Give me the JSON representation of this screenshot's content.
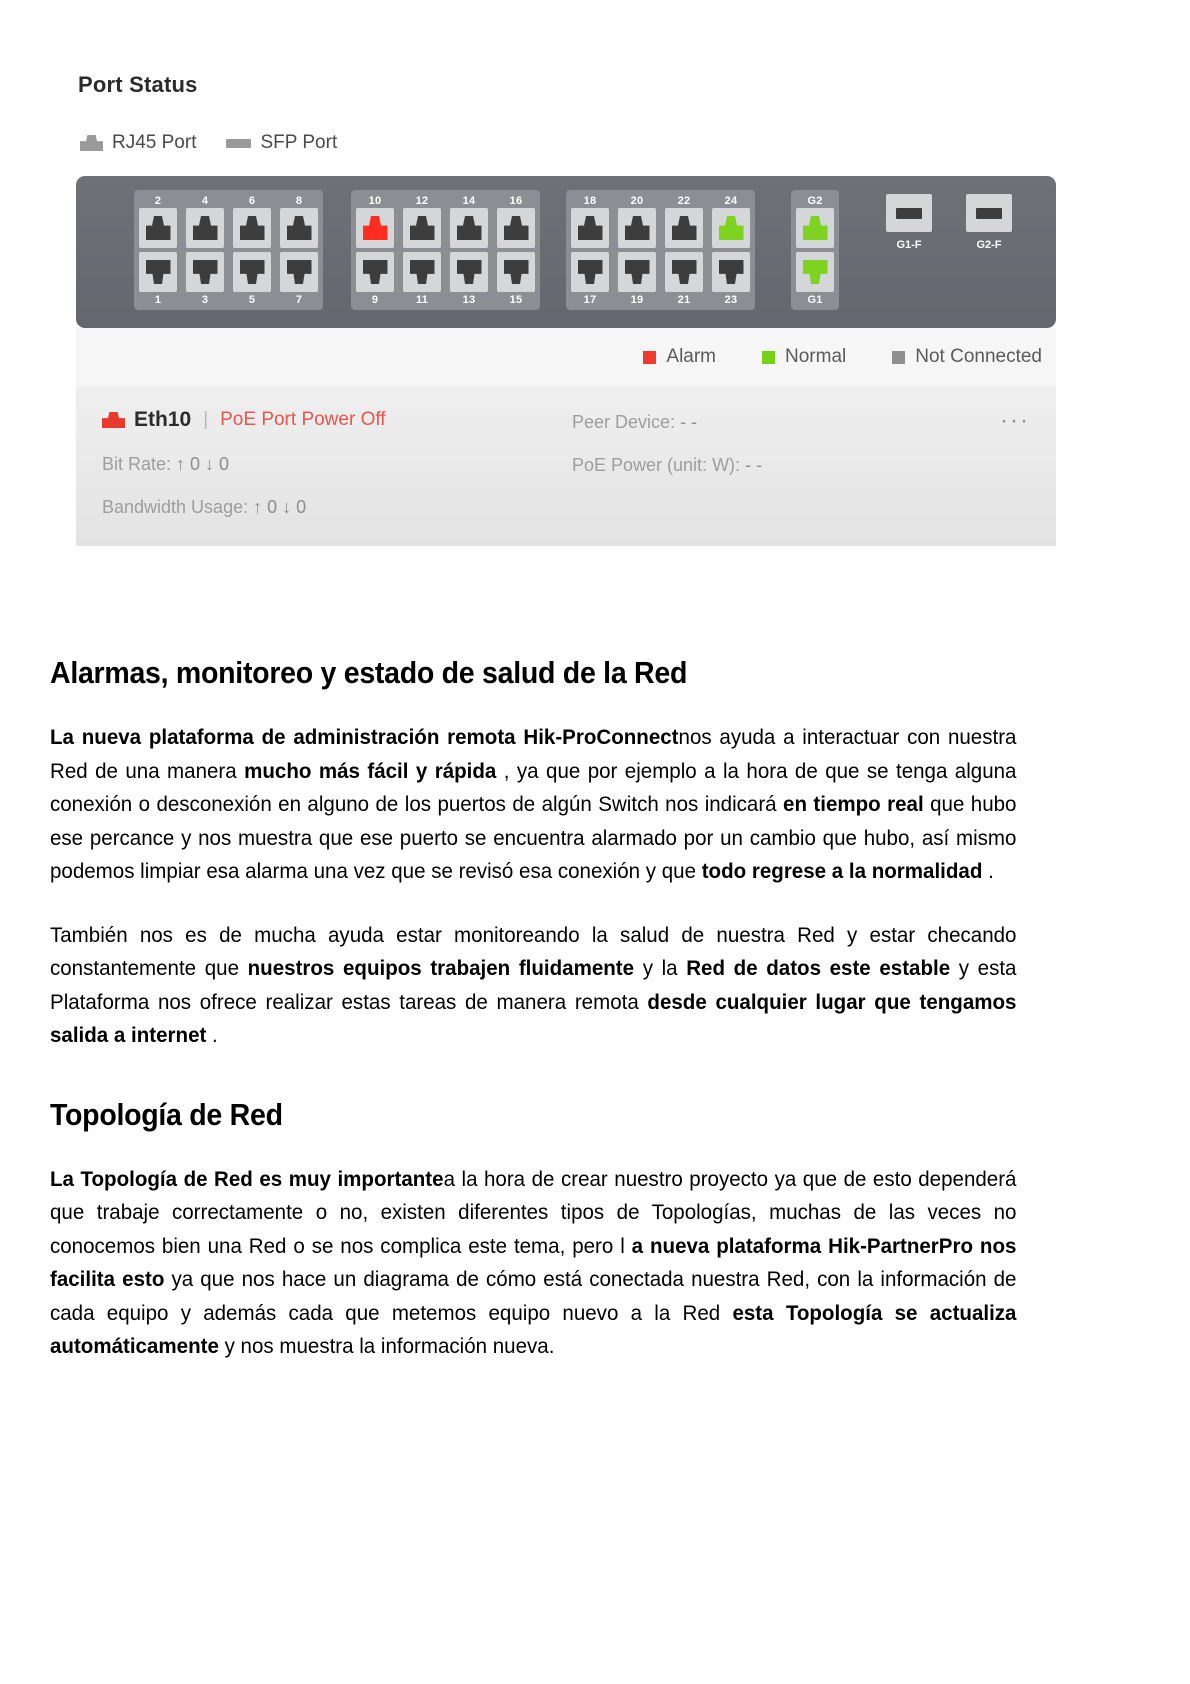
{
  "port_status": {
    "title": "Port Status",
    "top_legend": [
      {
        "icon": "rj45-port-icon",
        "label": "RJ45 Port"
      },
      {
        "icon": "sfp-port-icon",
        "label": "SFP Port"
      }
    ],
    "banks": [
      {
        "id": "bank-1",
        "top_labels": [
          "2",
          "4",
          "6",
          "8"
        ],
        "bottom_labels": [
          "1",
          "3",
          "5",
          "7"
        ],
        "top_states": [
          "not-connected",
          "not-connected",
          "not-connected",
          "not-connected"
        ],
        "bottom_states": [
          "not-connected",
          "not-connected",
          "not-connected",
          "not-connected"
        ]
      },
      {
        "id": "bank-2",
        "top_labels": [
          "10",
          "12",
          "14",
          "16"
        ],
        "bottom_labels": [
          "9",
          "11",
          "13",
          "15"
        ],
        "top_states": [
          "alarm",
          "not-connected",
          "not-connected",
          "not-connected"
        ],
        "bottom_states": [
          "not-connected",
          "not-connected",
          "not-connected",
          "not-connected"
        ]
      },
      {
        "id": "bank-3",
        "top_labels": [
          "18",
          "20",
          "22",
          "24"
        ],
        "bottom_labels": [
          "17",
          "19",
          "21",
          "23"
        ],
        "top_states": [
          "not-connected",
          "not-connected",
          "not-connected",
          "normal"
        ],
        "bottom_states": [
          "not-connected",
          "not-connected",
          "not-connected",
          "not-connected"
        ]
      },
      {
        "id": "bank-uplink",
        "top_labels": [
          "G2"
        ],
        "bottom_labels": [
          "G1"
        ],
        "top_states": [
          "normal"
        ],
        "bottom_states": [
          "normal"
        ]
      }
    ],
    "sfp_ports": [
      {
        "label": "G1-F"
      },
      {
        "label": "G2-F"
      }
    ],
    "legend": [
      {
        "label": "Alarm",
        "color": "#f03a2e"
      },
      {
        "label": "Normal",
        "color": "#76d216"
      },
      {
        "label": "Not Connected",
        "color": "#8f8f8f"
      }
    ],
    "colors": {
      "alarm": "#ff2d1f",
      "normal": "#7ed321",
      "not_connected": "#3d3d3d",
      "chassis": "#6a6e73"
    },
    "detail": {
      "port_name": "Eth10",
      "separator": "|",
      "poe_status": "PoE Port Power Off",
      "bit_rate_label": "Bit Rate:",
      "bit_rate_value": "↑ 0 ↓ 0",
      "bandwidth_label": "Bandwidth Usage:",
      "bandwidth_value": "↑ 0 ↓ 0",
      "peer_device_label": "Peer Device:",
      "peer_device_value": "- -",
      "poe_power_label": "PoE Power (unit: W):",
      "poe_power_value": "- -",
      "more_actions": "···"
    }
  },
  "article": {
    "heading_1": "Alarmas, monitoreo y estado de salud de la Red",
    "p1": {
      "a_bold": "La nueva plataforma de administración remota Hik-ProConnect",
      "b": "nos ayuda a interactuar con nuestra Red de una manera ",
      "c_bold": "mucho más fácil y rápida",
      "d": " , ya que por ejemplo a la hora de que se tenga alguna conexión o desconexión en alguno de los puertos de algún Switch nos indicará ",
      "e_bold": "en tiempo real",
      "f": " que hubo ese percance y nos muestra que ese puerto se encuentra alarmado por un cambio que hubo, así mismo podemos limpiar esa alarma una vez que se revisó esa conexión y que ",
      "g_bold": "todo regrese a la normalidad",
      "h": " ."
    },
    "p2": {
      "a": "También nos es de mucha ayuda estar monitoreando la salud de nuestra Red y estar checando constantemente que ",
      "b_bold": "nuestros equipos trabajen fluidamente",
      "c": " y la ",
      "d_bold": "Red de datos este estable",
      "e": " y esta Plataforma nos ofrece realizar estas tareas de manera remota ",
      "f_bold": "desde cualquier lugar que tengamos salida a internet",
      "g": " ."
    },
    "heading_2": "Topología de Red",
    "p3": {
      "a_bold": "La Topología de Red es muy importante",
      "b": "a la hora de crear nuestro proyecto ya que de esto dependerá que trabaje correctamente o no, existen diferentes tipos de Topologías, muchas de las veces no conocemos bien una Red o se nos complica este tema, pero l ",
      "c_bold": "a nueva plataforma Hik-PartnerPro nos facilita esto",
      "d": " ya que nos hace un diagrama de cómo está conectada nuestra Red, con la información de cada equipo y además cada que metemos equipo nuevo a la Red ",
      "e_bold": "esta Topología se actualiza automáticamente",
      "f": " y nos muestra la información nueva."
    }
  }
}
